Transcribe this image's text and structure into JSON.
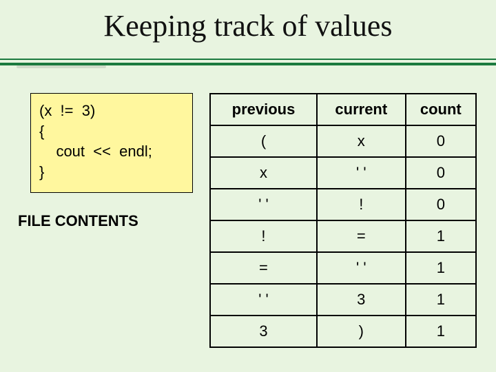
{
  "title": "Keeping track of values",
  "code": {
    "line1": "(x  !=  3)",
    "line2": "{",
    "line3": "    cout  <<  endl;",
    "line4": "}"
  },
  "file_label": "FILE CONTENTS",
  "table": {
    "headers": [
      "previous",
      "current",
      "count"
    ],
    "rows": [
      {
        "previous": "(",
        "current": "x",
        "count": "0"
      },
      {
        "previous": "x",
        "current": "' '",
        "count": "0"
      },
      {
        "previous": "' '",
        "current": "!",
        "count": "0"
      },
      {
        "previous": "!",
        "current": "=",
        "count": "1"
      },
      {
        "previous": "=",
        "current": "' '",
        "count": "1"
      },
      {
        "previous": "' '",
        "current": "3",
        "count": "1"
      },
      {
        "previous": "3",
        "current": ")",
        "count": "1"
      }
    ]
  },
  "chart_data": {
    "type": "table",
    "title": "Keeping track of values",
    "columns": [
      "previous",
      "current",
      "count"
    ],
    "rows": [
      [
        "(",
        "x",
        0
      ],
      [
        "x",
        "' '",
        0
      ],
      [
        "' '",
        "!",
        0
      ],
      [
        "!",
        "=",
        1
      ],
      [
        "=",
        "' '",
        1
      ],
      [
        "' '",
        "3",
        1
      ],
      [
        "3",
        ")",
        1
      ]
    ]
  }
}
